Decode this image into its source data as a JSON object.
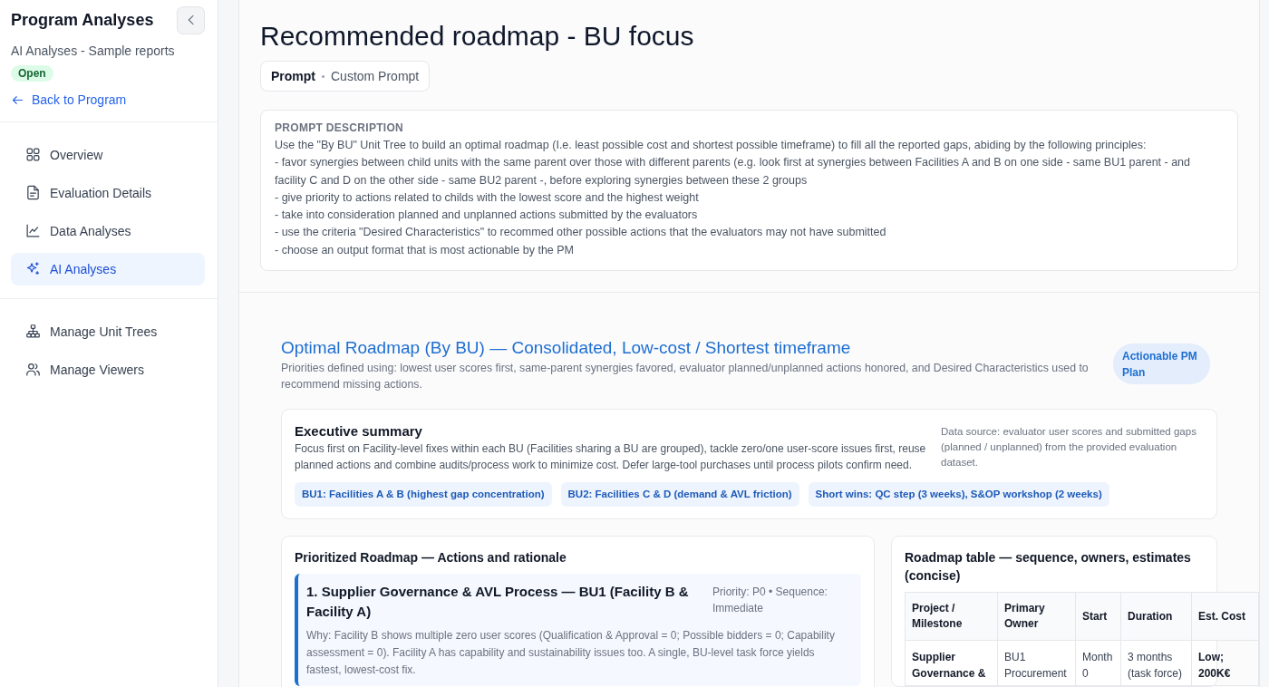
{
  "sidebar": {
    "title": "Program Analyses",
    "subtitle": "AI Analyses - Sample reports",
    "status_badge": "Open",
    "back_link": "Back to Program",
    "nav_sections": [
      {
        "items": [
          {
            "label": "Overview",
            "selected": false
          },
          {
            "label": "Evaluation Details",
            "selected": false
          },
          {
            "label": "Data Analyses",
            "selected": false
          },
          {
            "label": "AI Analyses",
            "selected": true
          }
        ]
      },
      {
        "items": [
          {
            "label": "Manage Unit Trees",
            "selected": false
          },
          {
            "label": "Manage Viewers",
            "selected": false
          }
        ]
      }
    ]
  },
  "page_header": {
    "title": "Recommended roadmap - BU focus",
    "tabs": [
      {
        "label": "Prompt",
        "selected": true
      },
      {
        "label": "Custom Prompt",
        "selected": false
      }
    ],
    "prompt_description": {
      "heading": "PROMPT DESCRIPTION",
      "text": "Use the \"By BU\" Unit Tree to build an optimal roadmap (I.e. least possible cost and shortest possible timeframe) to fill all the reported gaps, abiding by the following principles:\n- favor synergies between child units with the same parent over those with different parents (e.g. look first at synergies between Facilities A and B on one side - same BU1 parent - and facility C and D on the other side - same BU2 parent -, before exploring synergies between these 2 groups\n- give priority to actions related to childs with the lowest score and the highest weight\n- take into consideration planned and unplanned actions submitted by the evaluators\n- use the criteria \"Desired Characteristics\" to recommed other possible actions that the evaluators may not have submitted\n- choose an output format that is most actionable by the PM"
    }
  },
  "report": {
    "title": "Optimal Roadmap (By BU) — Consolidated, Low-cost / Shortest timeframe",
    "subtitle": "Priorities defined using: lowest user scores first, same-parent synergies favored, evaluator planned/unplanned actions honored, and Desired Characteristics used to recommend missing actions.",
    "badge": "Actionable PM Plan",
    "executive_summary": {
      "heading": "Executive summary",
      "text": "Focus first on Facility-level fixes within each BU (Facilities sharing a BU are grouped), tackle zero/one user-score issues first, reuse planned actions and combine audits/process work to minimize cost. Defer large-tool purchases until process pilots confirm need.",
      "data_source": "Data source: evaluator user scores and submitted gaps (planned / unplanned) from the provided evaluation dataset.",
      "chips": [
        "BU1: Facilities A & B (highest gap concentration)",
        "BU2: Facilities C & D (demand & AVL friction)",
        "Short wins: QC step (3 weeks), S&OP workshop (2 weeks)"
      ]
    },
    "prioritized_roadmap": {
      "heading": "Prioritized Roadmap — Actions and rationale",
      "actions": [
        {
          "title": "1. Supplier Governance & AVL Process — BU1 (Facility B & Facility A)",
          "meta": "Priority: P0 • Sequence: Immediate",
          "why": "Why: Facility B shows multiple zero user scores (Qualification & Approval = 0; Possible bidders = 0; Capability assessment = 0). Facility A has capability and sustainability issues too. A single, BU-level task force yields fastest, lowest-cost fix."
        }
      ]
    },
    "roadmap_table": {
      "heading": "Roadmap table — sequence, owners, estimates (concise)",
      "columns": [
        {
          "label": "Project / Milestone",
          "emphasis": true
        },
        {
          "label": "Primary Owner",
          "emphasis": false
        },
        {
          "label": "Start",
          "emphasis": false
        },
        {
          "label": "Duration",
          "emphasis": false
        },
        {
          "label": "Est. Cost",
          "emphasis": true
        }
      ],
      "rows": [
        [
          "Supplier Governance &",
          "BU1 Procurement",
          "Month 0",
          "3 months (task force)",
          "Low; 200K€"
        ]
      ]
    }
  }
}
